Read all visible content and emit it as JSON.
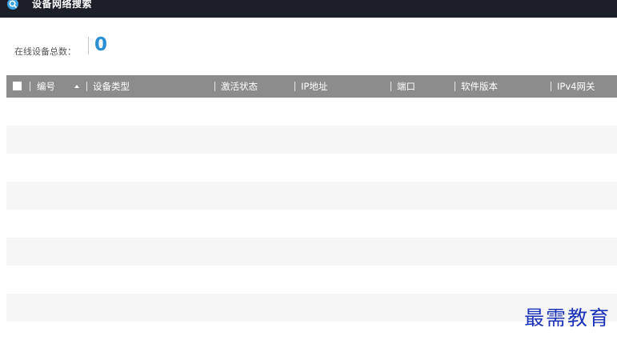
{
  "window": {
    "title": "设备网络搜索"
  },
  "summary": {
    "label": "在线设备总数：",
    "count": "0"
  },
  "table": {
    "columns": [
      "编号",
      "设备类型",
      "激活状态",
      "IP地址",
      "端口",
      "软件版本",
      "IPv4网关"
    ],
    "sort_icon": "sort-ascending-icon"
  },
  "watermark": "最需教育",
  "colors": {
    "titlebar": "#1b1f28",
    "header": "#8c8c8c",
    "accent": "#2b8fd6",
    "stripe": "#f6f6f6"
  }
}
